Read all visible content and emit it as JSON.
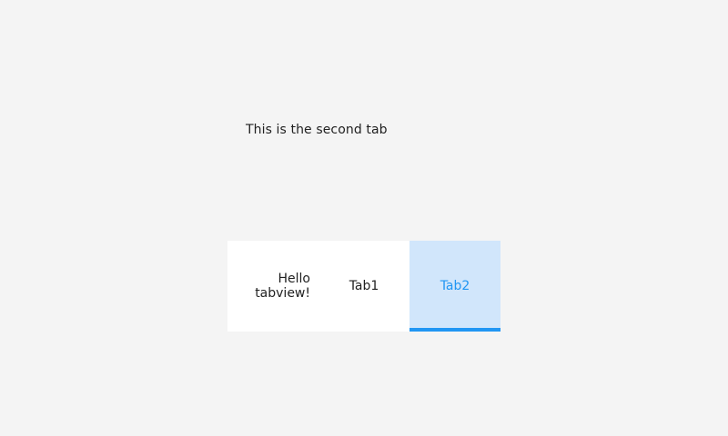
{
  "content": {
    "text": "This is the second tab"
  },
  "tabs": [
    {
      "label": "Hello tabview!",
      "active": false
    },
    {
      "label": "Tab1",
      "active": false
    },
    {
      "label": "Tab2",
      "active": true
    }
  ],
  "colors": {
    "background": "#f4f4f4",
    "tab_background": "#ffffff",
    "active_tab_background": "#d1e6fb",
    "accent": "#2196f3"
  }
}
